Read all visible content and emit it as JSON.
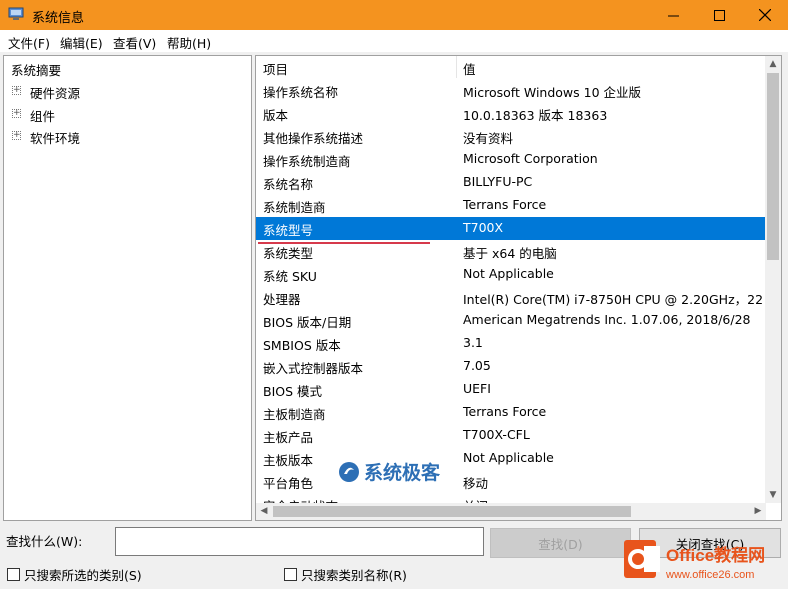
{
  "window": {
    "title": "系统信息"
  },
  "menu": [
    "文件(F)",
    "编辑(E)",
    "查看(V)",
    "帮助(H)"
  ],
  "tree": {
    "root": "系统摘要",
    "children": [
      "硬件资源",
      "组件",
      "软件环境"
    ]
  },
  "table": {
    "headers": [
      "项目",
      "值"
    ],
    "rows": [
      [
        "操作系统名称",
        "Microsoft Windows 10 企业版"
      ],
      [
        "版本",
        "10.0.18363 版本 18363"
      ],
      [
        "其他操作系统描述",
        "没有资料"
      ],
      [
        "操作系统制造商",
        "Microsoft Corporation"
      ],
      [
        "系统名称",
        "BILLYFU-PC"
      ],
      [
        "系统制造商",
        "Terrans Force"
      ],
      [
        "系统型号",
        "T700X"
      ],
      [
        "系统类型",
        "基于 x64 的电脑"
      ],
      [
        "系统 SKU",
        "Not Applicable"
      ],
      [
        "处理器",
        "Intel(R) Core(TM) i7-8750H CPU @ 2.20GHz，22"
      ],
      [
        "BIOS 版本/日期",
        "American Megatrends Inc. 1.07.06, 2018/6/28"
      ],
      [
        "SMBIOS 版本",
        "3.1"
      ],
      [
        "嵌入式控制器版本",
        "7.05"
      ],
      [
        "BIOS 模式",
        "UEFI"
      ],
      [
        "主板制造商",
        "Terrans Force"
      ],
      [
        "主板产品",
        "T700X-CFL"
      ],
      [
        "主板版本",
        "Not Applicable"
      ],
      [
        "平台角色",
        "移动"
      ],
      [
        "安全启动状态",
        "关闭"
      ]
    ],
    "selected_index": 6
  },
  "find": {
    "label": "查找什么(W):",
    "value": "",
    "find_button": "查找(D)",
    "close_button": "关闭查找(C)",
    "only_selected": "只搜索所选的类别(S)",
    "only_names": "只搜索类别名称(R)"
  },
  "watermarks": {
    "center": "系统极客",
    "brand": "Office教程网",
    "url": "www.office26.com"
  },
  "colors": {
    "titlebar": "#f4931f",
    "selection": "#0078d7",
    "underline": "#d6394b",
    "office_orange": "#e8541c"
  }
}
